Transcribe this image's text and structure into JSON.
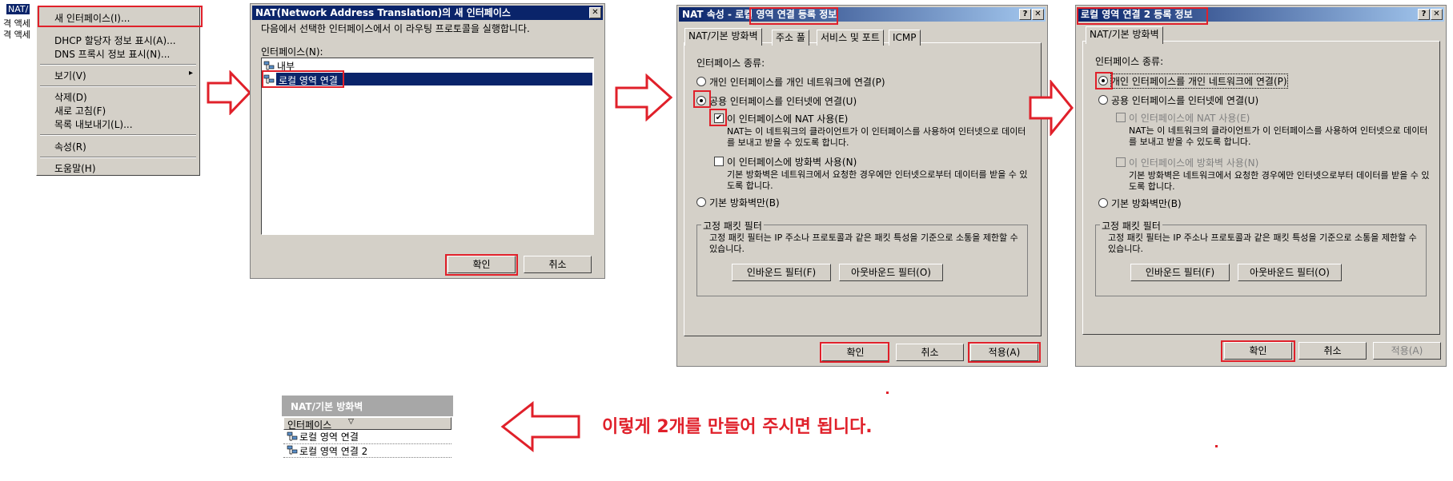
{
  "colors": {
    "highlight": "#e0202a",
    "titlebar": "#0a246a",
    "selection": "#0a246a",
    "caption": "#e0202a"
  },
  "left_tree": {
    "selected": "NAT/",
    "rows": [
      "격 액세",
      "격 액세"
    ]
  },
  "context_menu": {
    "items": [
      "새 인터페이스(I)...",
      "DHCP 할당자 정보 표시(A)...",
      "DNS 프록시 정보 표시(N)...",
      "보기(V)",
      "삭제(D)",
      "새로 고침(F)",
      "목록 내보내기(L)...",
      "속성(R)",
      "도움말(H)"
    ],
    "submenu_arrow": "▸"
  },
  "dialog1": {
    "title": "NAT(Network Address Translation)의 새 인터페이스",
    "close": "✕",
    "description": "다음에서 선택한 인터페이스에서 이 라우팅 프로토콜을 실행합니다.",
    "list_label": "인터페이스(N):",
    "items": [
      "내부",
      "로컬 영역 연결"
    ],
    "ok": "확인",
    "cancel": "취소"
  },
  "dialog2": {
    "title_prefix": "NAT 속성 - ",
    "title_highlight": "로컬 영역 연결",
    "title_suffix": " 등록 정보",
    "help": "?",
    "close": "✕",
    "tabs": [
      "NAT/기본 방화벽",
      "주소 풀",
      "서비스 및 포트",
      "ICMP"
    ],
    "type_label": "인터페이스 종류:",
    "radio_private": "개인 인터페이스를 개인 네트워크에 연결(P)",
    "radio_public": "공용 인터페이스를 인터넷에 연결(U)",
    "check_nat": "이 인터페이스에 NAT 사용(E)",
    "check_nat_mark": "✔",
    "nat_desc": "NAT는 이 네트워크의 클라이언트가 이 인터페이스를 사용하여 인터넷으로 데이터를 보내고 받을 수 있도록 합니다.",
    "check_fw": "이 인터페이스에 방화벽 사용(N)",
    "fw_desc": "기본 방화벽은 네트워크에서 요청한 경우에만 인터넷으로부터 데이터를 받을 수 있도록 합니다.",
    "radio_fw_only": "기본 방화벽만(B)",
    "filter_group": "고정 패킷 필터",
    "filter_desc": "고정 패킷 필터는 IP 주소나 프로토콜과 같은 패킷 특성을 기준으로 소통을 제한할 수 있습니다.",
    "inbound": "인바운드 필터(F)",
    "outbound": "아웃바운드 필터(O)",
    "ok": "확인",
    "cancel": "취소",
    "apply": "적용(A)"
  },
  "dialog3": {
    "title": "로컬 영역 연결 2 등록 정보",
    "help": "?",
    "close": "✕",
    "tab": "NAT/기본 방화벽",
    "type_label": "인터페이스 종류:",
    "radio_private": "개인 인터페이스를 개인 네트워크에 연결(P)",
    "radio_public": "공용 인터페이스를 인터넷에 연결(U)",
    "check_nat": "이 인터페이스에 NAT 사용(E)",
    "nat_desc": "NAT는 이 네트워크의 클라이언트가 이 인터페이스를 사용하여 인터넷으로 데이터를 보내고 받을 수 있도록 합니다.",
    "check_fw": "이 인터페이스에 방화벽 사용(N)",
    "fw_desc": "기본 방화벽은 네트워크에서 요청한 경우에만 인터넷으로부터 데이터를 받을 수 있도록 합니다.",
    "radio_fw_only": "기본 방화벽만(B)",
    "filter_group": "고정 패킷 필터",
    "filter_desc": "고정 패킷 필터는 IP 주소나 프로토콜과 같은 패킷 특성을 기준으로 소통을 제한할 수 있습니다.",
    "inbound": "인바운드 필터(F)",
    "outbound": "아웃바운드 필터(O)",
    "ok": "확인",
    "cancel": "취소",
    "apply": "적용(A)"
  },
  "result_panel": {
    "header": "NAT/기본 방화벽",
    "column": "인터페이스",
    "sort_glyph": "▽",
    "rows": [
      "로컬 영역 연결",
      "로컬 영역 연결 2"
    ]
  },
  "caption": "이렇게 2개를 만들어 주시면 됩니다."
}
